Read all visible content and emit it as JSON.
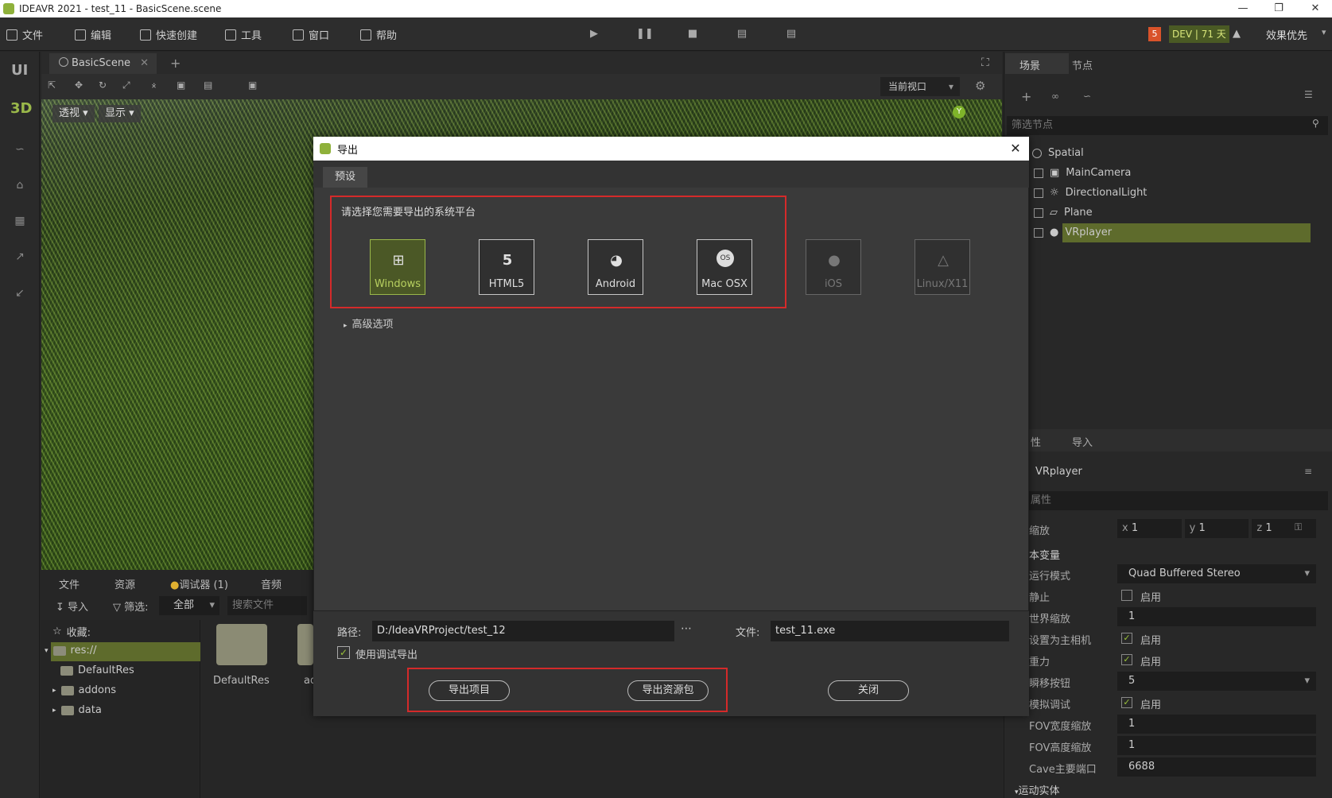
{
  "window": {
    "title": "IDEAVR 2021 - test_11 - BasicScene.scene"
  },
  "menubar": {
    "items": [
      "文件",
      "编辑",
      "快速创建",
      "工具",
      "窗口",
      "帮助"
    ],
    "dev_badge": "DEV | 71 天",
    "quality": "效果优先"
  },
  "left_strip": {
    "ui": "UI",
    "three_d": "3D"
  },
  "scene": {
    "tab": "BasicScene",
    "viewport_mode": "当前视口",
    "perspective": "透视",
    "display": "显示"
  },
  "filesystem": {
    "tabs": [
      "文件",
      "资源",
      "调试器 (1)",
      "音频"
    ],
    "import": "导入",
    "filter": "筛选:",
    "filter_value": "全部",
    "search_placeholder": "搜索文件",
    "favorites": "收藏:",
    "root": "res://",
    "folders": [
      "DefaultRes",
      "addons",
      "data"
    ],
    "grid_items": [
      "DefaultRes",
      "ad"
    ]
  },
  "scene_tree": {
    "tabs": [
      "场景",
      "节点"
    ],
    "filter_placeholder": "筛选节点",
    "nodes": [
      "Spatial",
      "MainCamera",
      "DirectionalLight",
      "Plane",
      "VRplayer"
    ]
  },
  "inspector": {
    "tabs": [
      "性",
      "导入"
    ],
    "node": "VRplayer",
    "filter_placeholder": "属性",
    "scale_label": "缩放",
    "scale": {
      "x": "1",
      "y": "1",
      "z": "1"
    },
    "section": "本变量",
    "props": [
      {
        "label": "运行模式",
        "value": "Quad Buffered Stereo"
      },
      {
        "label": "静止",
        "check": "启用",
        "checked": false
      },
      {
        "label": "世界缩放",
        "value": "1"
      },
      {
        "label": "设置为主相机",
        "check": "启用",
        "checked": true
      },
      {
        "label": "重力",
        "check": "启用",
        "checked": true
      },
      {
        "label": "瞬移按钮",
        "value": "5"
      },
      {
        "label": "模拟调试",
        "check": "启用",
        "checked": true
      },
      {
        "label": "FOV宽度缩放",
        "value": "1"
      },
      {
        "label": "FOV高度缩放",
        "value": "1"
      },
      {
        "label": "Cave主要端口",
        "value": "6688"
      }
    ],
    "section2": "运动实体"
  },
  "dialog": {
    "title": "导出",
    "preset_tab": "预设",
    "prompt": "请选择您需要导出的系统平台",
    "platforms": [
      {
        "label": "Windows",
        "icon": "windows-icon",
        "state": "selected"
      },
      {
        "label": "HTML5",
        "icon": "html5-icon",
        "state": "normal"
      },
      {
        "label": "Android",
        "icon": "android-icon",
        "state": "normal"
      },
      {
        "label": "Mac OSX",
        "icon": "apple-os-icon",
        "state": "normal"
      },
      {
        "label": "iOS",
        "icon": "apple-icon",
        "state": "disabled"
      },
      {
        "label": "Linux/X11",
        "icon": "linux-icon",
        "state": "disabled"
      }
    ],
    "advanced": "高级选项",
    "path_label": "路径:",
    "path_value": "D:/IdeaVRProject/test_12",
    "file_label": "文件:",
    "file_value": "test_11.exe",
    "debug_label": "使用调试导出",
    "export_project": "导出项目",
    "export_pack": "导出资源包",
    "close": "关闭"
  },
  "colors": {
    "accent": "#9ab84a",
    "highlight_border": "#d42a2a"
  }
}
